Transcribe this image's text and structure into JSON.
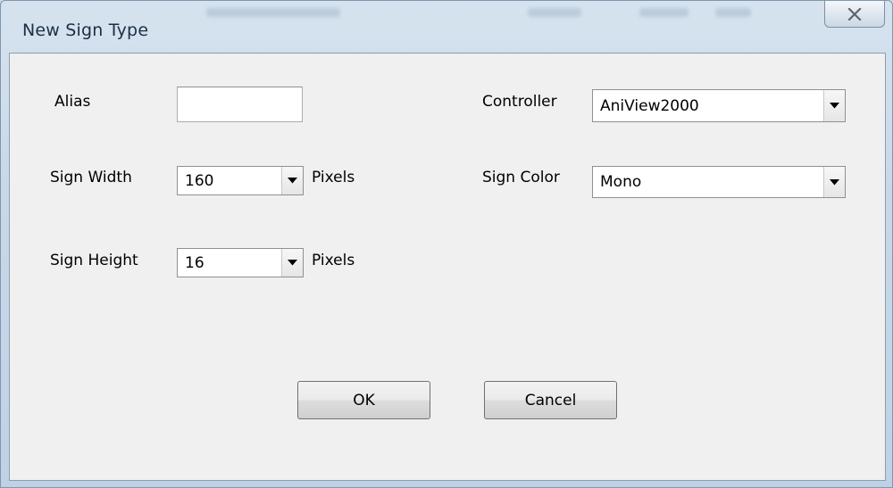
{
  "window": {
    "title": "New Sign Type",
    "close_icon": "close-x-icon"
  },
  "form": {
    "alias": {
      "label": "Alias",
      "value": ""
    },
    "sign_width": {
      "label": "Sign Width",
      "value": "160",
      "unit": "Pixels"
    },
    "sign_height": {
      "label": "Sign Height",
      "value": "16",
      "unit": "Pixels"
    },
    "controller": {
      "label": "Controller",
      "value": "AniView2000"
    },
    "sign_color": {
      "label": "Sign Color",
      "value": "Mono"
    }
  },
  "buttons": {
    "ok_label": "OK",
    "cancel_label": "Cancel"
  },
  "colors": {
    "dialog_background": "#f0f0f0",
    "frame": "#c8d8e8"
  }
}
